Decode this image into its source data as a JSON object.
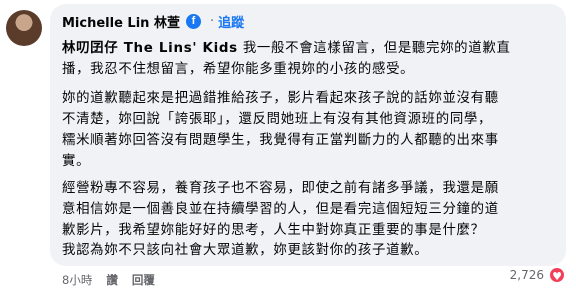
{
  "comment": {
    "author": "Michelle Lin 林萱",
    "author_badge": "f",
    "separator": "·",
    "follow_label": "追蹤",
    "mention": "林叨囝仔 The Lins' Kids",
    "paragraphs": [
      [
        "我一般不會這樣留言，但是聽完妳的道歉直",
        "播，我忍不住想留言，希望你能多重視妳的小孩的感受。"
      ],
      [
        "妳的道歉聽起來是把過錯推給孩子，影片看起來孩子說的話妳並沒有聽",
        "不清楚，妳回說「誇張耶」，還反問她班上有沒有其他資源班的同學，",
        "糯米順著妳回答沒有問題學生，我覺得有正當判斷力的人都聽的出來事",
        "實。"
      ],
      [
        "經營粉專不容易，養育孩子也不容易，即使之前有諸多爭議，我還是願",
        "意相信妳是一個善良並在持續學習的人，但是看完這個短短三分鐘的道",
        "歉影片，我希望妳能好好的思考，人生中對妳真正重要的事是什麼？"
      ],
      [
        "我認為妳不只該向社會大眾道歉，妳更該對你的孩子道歉。"
      ]
    ]
  },
  "actions": {
    "time": "8小時",
    "like": "讚",
    "reply": "回覆"
  },
  "reactions": {
    "count": "2,726",
    "icon": "heart-icon",
    "color": "#f33e58"
  }
}
